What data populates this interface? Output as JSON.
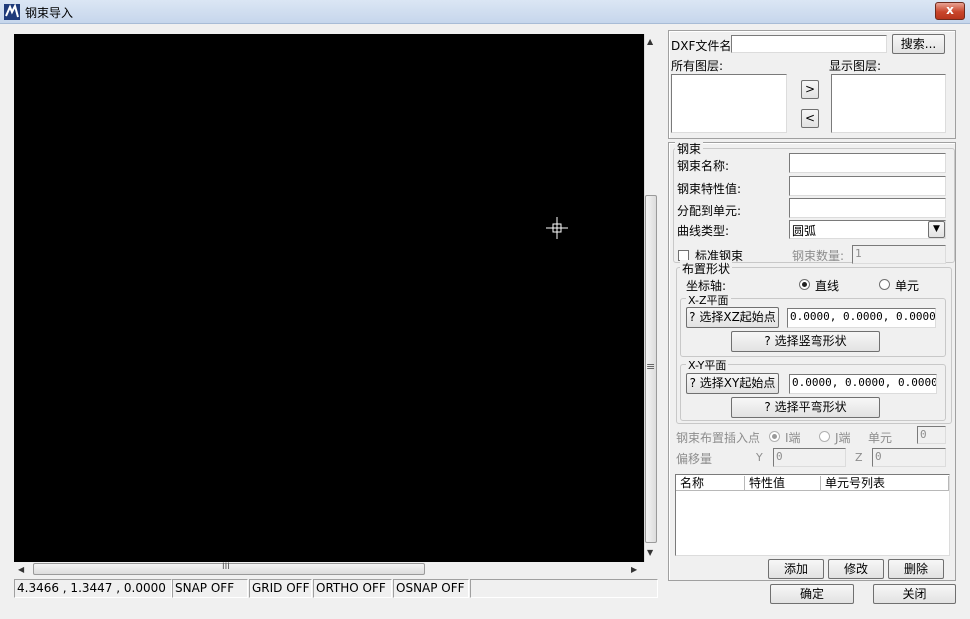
{
  "window": {
    "title": "钢束导入",
    "close_glyph": "x",
    "icon": "app-icon"
  },
  "canvas": {
    "background": "#000000",
    "cursor_icon": "crosshair-cursor-icon",
    "hscroll_grip": "III",
    "vscroll_grip": "≡"
  },
  "status_bar": {
    "coords": "4.3466 , 1.3447 , 0.0000",
    "snap": "SNAP OFF",
    "grid": "GRID OFF",
    "ortho": "ORTHO OFF",
    "osnap": "OSNAP OFF"
  },
  "dxf": {
    "file_label": "DXF文件名:",
    "file_value": "",
    "search_button": "搜索...",
    "all_layers_label": "所有图层:",
    "shown_layers_label": "显示图层:",
    "add_arrow": ">",
    "remove_arrow": "<"
  },
  "tendon": {
    "group_title": "钢束",
    "name_label": "钢束名称:",
    "name_value": "",
    "property_label": "钢束特性值:",
    "property_value": "",
    "assign_label": "分配到单元:",
    "assign_value": "",
    "curve_type_label": "曲线类型:",
    "curve_type_value": "圆弧",
    "standard_label": "标准钢束",
    "count_label": "钢束数量:",
    "count_value": "1"
  },
  "layout_shape": {
    "group_title": "布置形状",
    "axis_label": "坐标轴:",
    "axis_line": "直线",
    "axis_element": "单元",
    "xz_title": "X-Z平面",
    "xz_start_button": "? 选择XZ起始点",
    "xz_start_value": "0.0000,  0.0000,  0.0000",
    "xz_shape_button": "? 选择竖弯形状",
    "xy_title": "X-Y平面",
    "xy_start_button": "? 选择XY起始点",
    "xy_start_value": "0.0000,  0.0000,  0.0000",
    "xy_shape_button": "? 选择平弯形状"
  },
  "insert": {
    "label": "钢束布置插入点",
    "i_end": "I端",
    "j_end": "J端",
    "element_label": "单元",
    "element_value": "0",
    "offset_label": "偏移量",
    "y_label": "Y",
    "y_value": "0",
    "z_label": "Z",
    "z_value": "0"
  },
  "table": {
    "columns": [
      "名称",
      "特性值",
      "单元号列表"
    ],
    "rows": []
  },
  "actions": {
    "add": "添加",
    "modify": "修改",
    "delete": "删除",
    "ok": "确定",
    "close": "关闭"
  }
}
